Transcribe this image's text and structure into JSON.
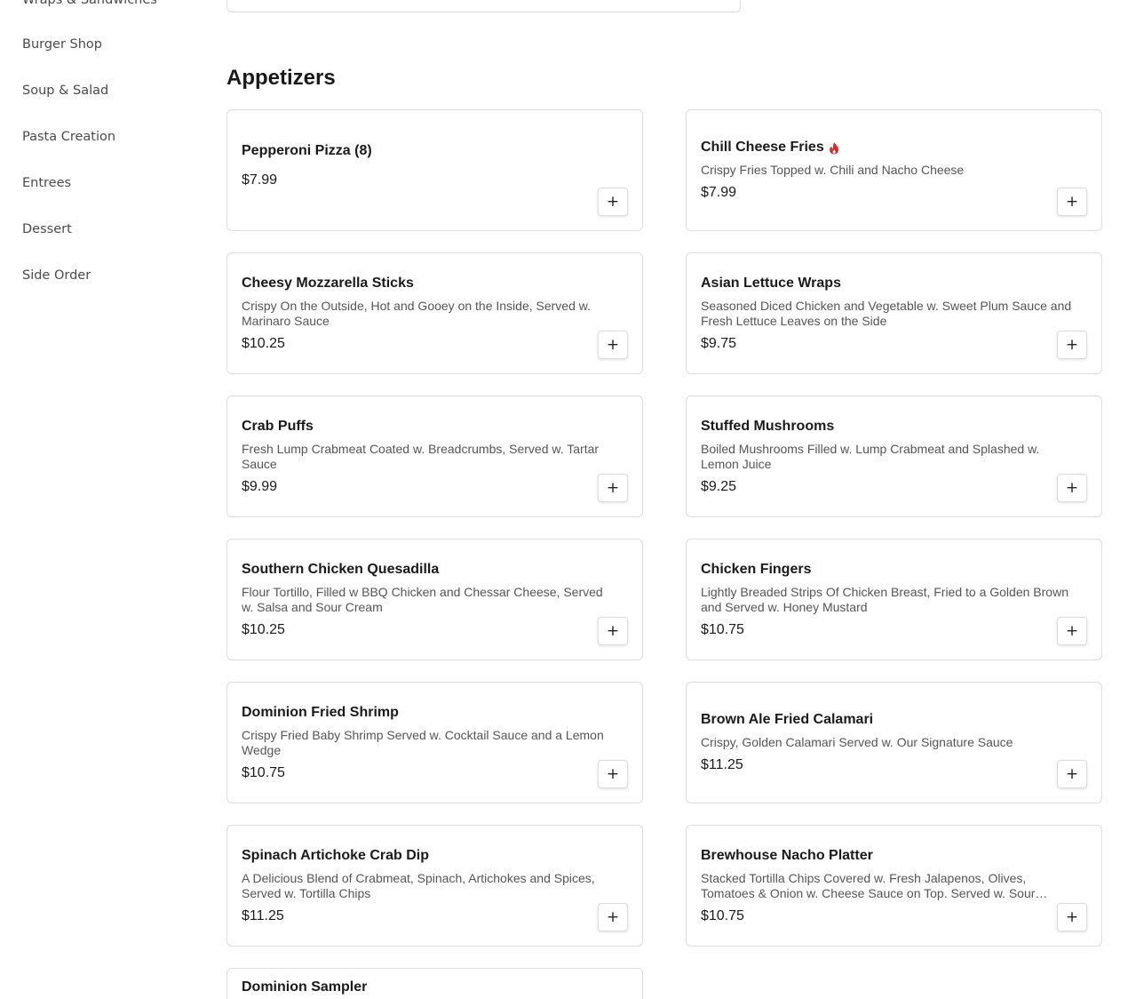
{
  "sidebar": {
    "items": [
      {
        "label": "Wraps & Sandwiches"
      },
      {
        "label": "Burger Shop"
      },
      {
        "label": "Soup & Salad"
      },
      {
        "label": "Pasta Creation"
      },
      {
        "label": "Entrees"
      },
      {
        "label": "Dessert"
      },
      {
        "label": "Side Order"
      }
    ]
  },
  "section": {
    "title": "Appetizers"
  },
  "colors": {
    "spicy": "#d0312d",
    "border": "#dcdcdc"
  },
  "add_button": {
    "label": "+"
  },
  "items": [
    {
      "name": "Pepperoni Pizza (8)",
      "description": "",
      "price": "$7.99",
      "spicy": false
    },
    {
      "name": "Chill Cheese Fries",
      "description": "Crispy Fries Topped w. Chili and Nacho Cheese",
      "price": "$7.99",
      "spicy": true
    },
    {
      "name": "Cheesy Mozzarella Sticks",
      "description": "Crispy On the Outside, Hot and Gooey on the Inside, Served w. Marinaro Sauce",
      "price": "$10.25",
      "spicy": false
    },
    {
      "name": "Asian Lettuce Wraps",
      "description": "Seasoned Diced Chicken and Vegetable w. Sweet Plum Sauce and Fresh Lettuce Leaves on the Side",
      "price": "$9.75",
      "spicy": false
    },
    {
      "name": "Crab Puffs",
      "description": "Fresh Lump Crabmeat Coated w. Breadcrumbs, Served w. Tartar Sauce",
      "price": "$9.99",
      "spicy": false
    },
    {
      "name": "Stuffed Mushrooms",
      "description": "Boiled Mushrooms Filled w. Lump Crabmeat and Splashed w. Lemon Juice",
      "price": "$9.25",
      "spicy": false
    },
    {
      "name": "Southern Chicken Quesadilla",
      "description": "Flour Tortillo, Filled w BBQ Chicken and Chessar Cheese, Served w. Salsa and Sour Cream",
      "price": "$10.25",
      "spicy": false
    },
    {
      "name": "Chicken Fingers",
      "description": "Lightly Breaded Strips Of Chicken Breast, Fried to a Golden Brown and Served w. Honey Mustard",
      "price": "$10.75",
      "spicy": false
    },
    {
      "name": "Dominion Fried Shrimp",
      "description": "Crispy Fried Baby Shrimp Served w. Cocktail Sauce and a Lemon Wedge",
      "price": "$10.75",
      "spicy": false
    },
    {
      "name": "Brown Ale Fried Calamari",
      "description": "Crispy, Golden Calamari Served w. Our Signature Sauce",
      "price": "$11.25",
      "spicy": false
    },
    {
      "name": "Spinach Artichoke Crab Dip",
      "description": "A Delicious Blend of Crabmeat, Spinach, Artichokes and Spices, Served w. Tortilla Chips",
      "price": "$11.25",
      "spicy": false
    },
    {
      "name": "Brewhouse Nacho Platter",
      "description": "Stacked Tortilla Chips Covered w. Fresh Jalapenos, Olives, Tomatoes & Onion w. Cheese Sauce on Top. Served w. Sour Cream, Salsa",
      "price": "$10.75",
      "spicy": false
    },
    {
      "name": "Dominion Sampler",
      "description": "",
      "price": "",
      "spicy": false
    }
  ]
}
